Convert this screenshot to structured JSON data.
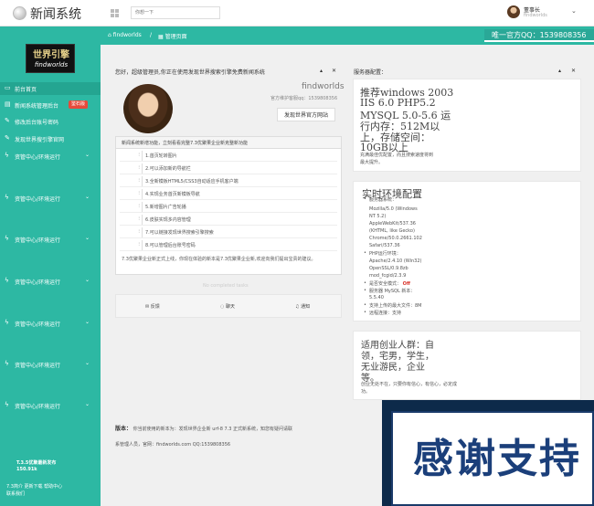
{
  "app": {
    "title": "新闻系统"
  },
  "header": {
    "search_placeholder": "你想一下",
    "user_name": "董事长",
    "user_sub": "findworlds"
  },
  "sidebar": {
    "logo_cn": "世界引擎",
    "logo_en": "findworlds",
    "items": [
      {
        "label": "前台首页",
        "icon": "monitor-icon"
      },
      {
        "label": "新闻系统管理后台",
        "icon": "document-icon",
        "badge": "鉴石版"
      },
      {
        "label": "修改后台账号密码",
        "icon": "wrench-icon"
      },
      {
        "label": "发现世界搜引擎官网",
        "icon": "wrench-icon"
      },
      {
        "label": "资管中心/环境运行",
        "icon": "bolt-icon"
      },
      {
        "label": "资管中心/环境运行",
        "icon": "bolt-icon"
      },
      {
        "label": "资管中心/环境运行",
        "icon": "bolt-icon"
      },
      {
        "label": "资管中心/环境运行",
        "icon": "bolt-icon"
      },
      {
        "label": "资管中心/环境运行",
        "icon": "bolt-icon"
      },
      {
        "label": "资管中心/环境运行",
        "icon": "bolt-icon"
      },
      {
        "label": "资管中心/环境运行",
        "icon": "bolt-icon"
      }
    ],
    "version": "T.3.5优聚最新发布\n150.91k",
    "footer": "7.3简介 更新下载 帮助中心\n联系我们"
  },
  "breadcrumb": {
    "home": "findworlds",
    "separator": "/",
    "page": "管理页面",
    "qq_notice": "唯一官方QQ：1539808356"
  },
  "welcome": {
    "text": "您好，超级管理员,你正在使用发现世界搜索引擎免费新闻系统",
    "name": "findworlds",
    "qq": "官方维护客服qq：1539808356",
    "visit_button": "发现世界官方网站"
  },
  "features": {
    "heading": "新闻系统新增功能，立刻看看完整7.3优聚果企业新克整新功能",
    "items": [
      "1.首页轮转图片",
      "2.可以添加新的导航栏",
      "3.全新模板HTML5/CSS3自动适应手机客户端",
      "4.实现业务首页新模板导航",
      "5.新增图片广告轮播",
      "6.皮肤实现多内容管理",
      "7.可以链接发现世界搜索引擎搜索",
      "8.可以管理后台账号密码"
    ],
    "note": "7.3优聚果企业新正式上线，你现在体验的新本是7.3优聚果企业新,欢迎向我们提出宝贵的建议。",
    "more": "No completed tasks"
  },
  "actions": {
    "feedback": "反馈",
    "chat": "聊天",
    "notify": "通知"
  },
  "copyright": {
    "label": "版本：",
    "text": "你当前使用的新本为：发现世界企业新 urf-8 7.3 正式新系统，知您有疑问请联",
    "line2": "系管理人员，官网：findworlds.com QQ:1539808356"
  },
  "server": {
    "heading": "服务器配置：",
    "rec_title": "推荐windows 2003",
    "rec_lines": [
      "IIS 6.0 PHP5.2",
      "MYSQL 5.0-5.6 运",
      "行内存：512M以",
      "上，存储空间：",
      "10GB以上"
    ],
    "rec_note": "充满最佳优配置，而且搜索速度将到最大提升。"
  },
  "env": {
    "title": "实时环境配置",
    "items": [
      "服务器系统：",
      "Mozilla/5.0 (Windows",
      "NT 5.2)",
      "AppleWebKit/537.36",
      "(KHTML, like Gecko)",
      "Chrome/50.0.2661.102",
      "Safari/537.36",
      "PHP运行环境：",
      "Apache/2.4.10 (Win32)",
      "OpenSSL/0.9.8zb",
      "mod_fcgid/2.3.9",
      "是否安全模式：",
      "服务器 MySQL 新本：",
      "5.5.40",
      "支持上传的最大文件：8M",
      "远程连接：支持"
    ],
    "safe_mode_value": "Off",
    "off_color": "#d9342b"
  },
  "audience": {
    "lines": [
      "适用创业人群：自",
      "领，宅男，学生，",
      "无业游民，企业",
      "等。"
    ],
    "note": "创业无处不在，只要你有信心，有信心，必定成功。"
  },
  "banner": {
    "text": "感谢支持"
  },
  "colors": {
    "accent": "#2db8a3",
    "badge": "#e64a3b"
  }
}
